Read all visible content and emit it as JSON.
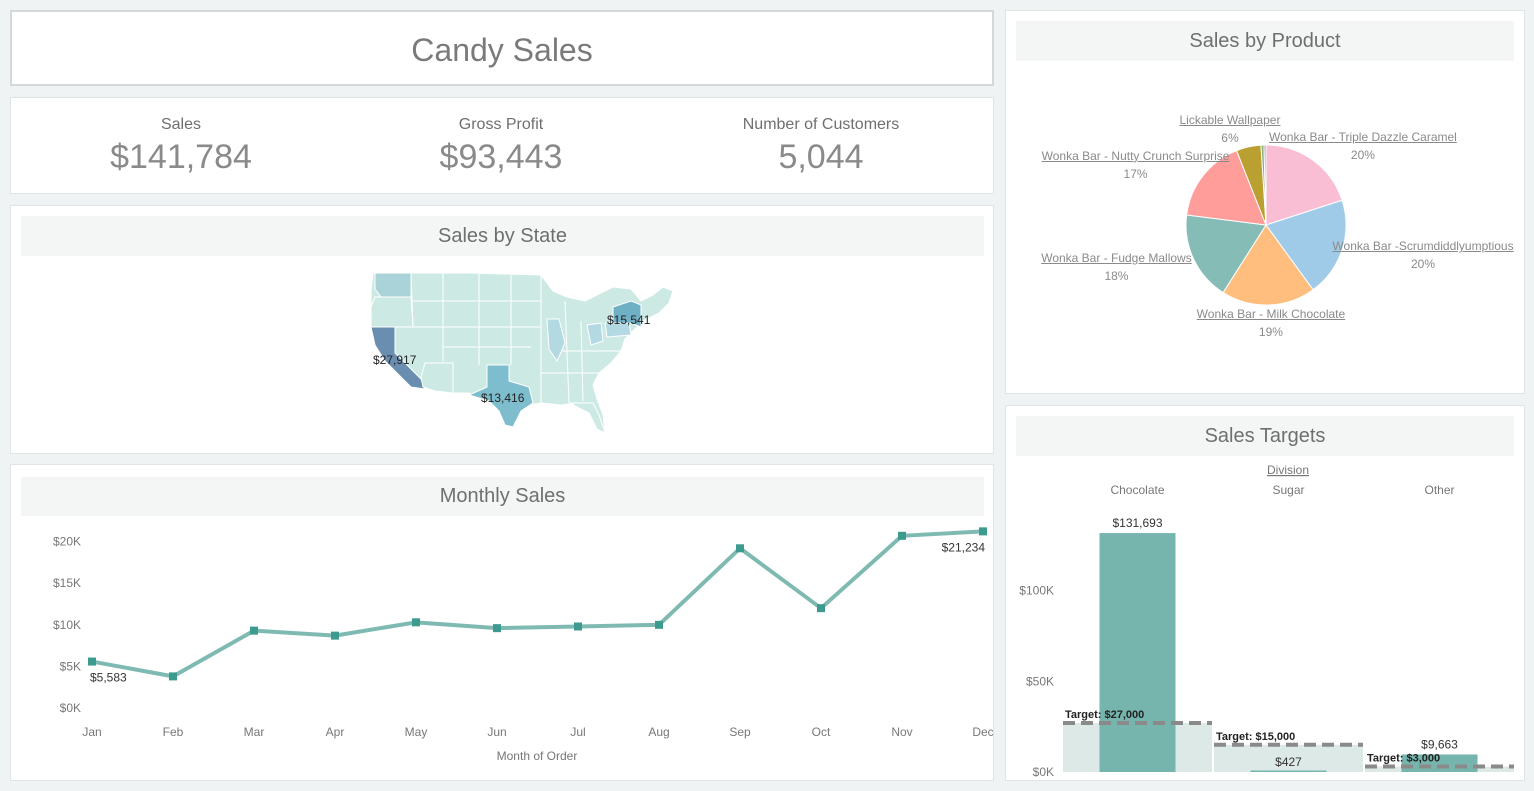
{
  "header": {
    "title": "Candy Sales"
  },
  "kpis": [
    {
      "label": "Sales",
      "value": "$141,784"
    },
    {
      "label": "Gross Profit",
      "value": "$93,443"
    },
    {
      "label": "Number of Customers",
      "value": "5,044"
    }
  ],
  "state_map": {
    "title": "Sales by State",
    "labels": [
      {
        "state": "California",
        "value": "$27,917"
      },
      {
        "state": "New York",
        "value": "$15,541"
      },
      {
        "state": "Texas",
        "value": "$13,416"
      }
    ]
  },
  "product_pie": {
    "title": "Sales by Product"
  },
  "targets": {
    "title": "Sales Targets"
  },
  "monthly": {
    "title": "Monthly Sales"
  },
  "chart_data": [
    {
      "type": "line",
      "title": "Monthly Sales",
      "xlabel": "Month of Order",
      "ylabel": "",
      "categories": [
        "Jan",
        "Feb",
        "Mar",
        "Apr",
        "May",
        "Jun",
        "Jul",
        "Aug",
        "Sep",
        "Oct",
        "Nov",
        "Dec"
      ],
      "values": [
        5583,
        3800,
        9300,
        8700,
        10300,
        9600,
        9800,
        10000,
        19200,
        12000,
        20700,
        21234
      ],
      "ylim": [
        0,
        22000
      ],
      "yticks": [
        "$0K",
        "$5K",
        "$10K",
        "$15K",
        "$20K"
      ],
      "ytick_values": [
        0,
        5000,
        10000,
        15000,
        20000
      ],
      "data_labels": [
        {
          "index": 0,
          "text": "$5,583"
        },
        {
          "index": 11,
          "text": "$21,234"
        }
      ],
      "color": "#7fbab2",
      "marker_color": "#3d9a8f"
    },
    {
      "type": "pie",
      "title": "Sales by Product",
      "slices": [
        {
          "name": "Wonka Bar - Triple Dazzle Caramel",
          "share": 20,
          "label": "20%",
          "color": "#f9bed3"
        },
        {
          "name": "Wonka Bar -Scrumdiddlyumptious",
          "share": 20,
          "label": "20%",
          "color": "#a0cbe8"
        },
        {
          "name": "Wonka Bar - Milk Chocolate",
          "share": 19,
          "label": "19%",
          "color": "#ffbe7d"
        },
        {
          "name": "Wonka Bar - Fudge Mallows",
          "share": 18,
          "label": "18%",
          "color": "#86bcb6"
        },
        {
          "name": "Wonka Bar - Nutty Crunch Surprise",
          "share": 17,
          "label": "17%",
          "color": "#ff9d9a"
        },
        {
          "name": "Lickable Wallpaper",
          "share": 5,
          "label": "6%",
          "color": "#b9a030"
        },
        {
          "name": "",
          "share": 0.6,
          "label": "",
          "color": "#8cae7a"
        },
        {
          "name": "",
          "share": 0.4,
          "label": "",
          "color": "#9aa0a0"
        }
      ]
    },
    {
      "type": "bar",
      "title": "Sales Targets",
      "facet_label": "Division",
      "categories": [
        "Chocolate",
        "Sugar",
        "Other"
      ],
      "values": [
        131693,
        427,
        9663
      ],
      "value_labels": [
        "$131,693",
        "$427",
        "$9,663"
      ],
      "targets": [
        27000,
        15000,
        3000
      ],
      "target_labels": [
        "Target: $27,000",
        "Target: $15,000",
        "Target: $3,000"
      ],
      "ylim": [
        0,
        140000
      ],
      "yticks": [
        "$0K",
        "$50K",
        "$100K"
      ],
      "ytick_values": [
        0,
        50000,
        100000
      ],
      "bar_color": "#76b5ad",
      "band_color": "#dde9e6",
      "target_color": "#8a8a8a"
    }
  ]
}
